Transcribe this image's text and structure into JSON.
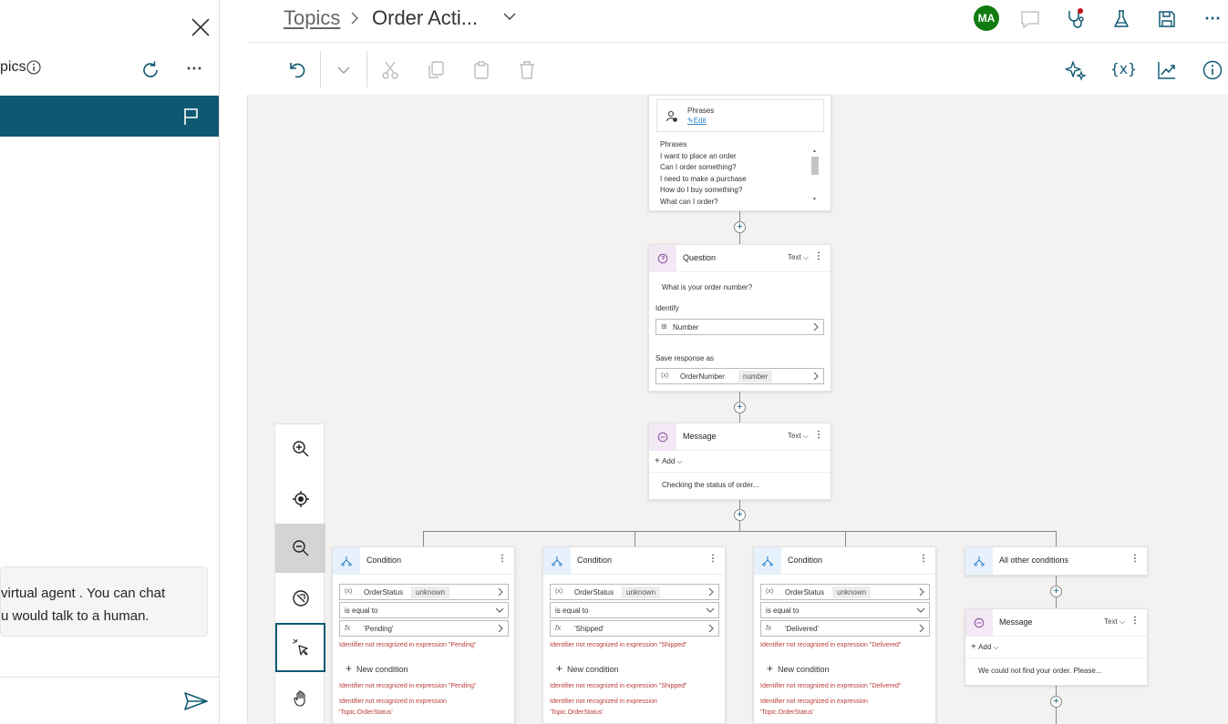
{
  "chat": {
    "title": "pics",
    "more": "⋯",
    "bubble_line1": " virtual agent . You can chat",
    "bubble_line2": "u would talk to a human."
  },
  "header": {
    "crumb_root": "Topics",
    "crumb_current": "Order Acti...",
    "avatar_initials": "MA",
    "more": "⋯"
  },
  "canvas": {
    "trigger": {
      "label": "Phrases",
      "edit": "Edit",
      "list_title": "Phrases",
      "phrases": [
        "I want to place an order",
        "Can I order something?",
        "I need to make a purchase",
        "How do I buy something?",
        "What can I order?"
      ]
    },
    "question": {
      "title": "Question",
      "type": "Text",
      "prompt": "What is your order number?",
      "identify_label": "Identify",
      "identify_value": "Number",
      "save_label": "Save response as",
      "var_name": "OrderNumber",
      "var_type": "number"
    },
    "message": {
      "title": "Message",
      "type": "Text",
      "add": "Add",
      "text": "Checking the status of order..."
    },
    "conditions": [
      {
        "title": "Condition",
        "var": "OrderStatus",
        "var_type": "unknown",
        "operator": "is equal to",
        "value": "'Pending'",
        "err1": "Identifier not recognized in expression \"Pending\"",
        "new": "New condition",
        "err2": "Identifier not recognized in expression \"Pending\"",
        "err3a": "Identifier not recognized in expression",
        "err3b": "'Topic.OrderStatus'"
      },
      {
        "title": "Condition",
        "var": "OrderStatus",
        "var_type": "unknown",
        "operator": "is equal to",
        "value": "'Shipped'",
        "err1": "Identifier not recognized in expression \"Shipped\"",
        "new": "New condition",
        "err2": "Identifier not recognized in expression \"Shipped\"",
        "err3a": "Identifier not recognized in expression",
        "err3b": "'Topic.OrderStatus'"
      },
      {
        "title": "Condition",
        "var": "OrderStatus",
        "var_type": "unknown",
        "operator": "is equal to",
        "value": "'Delivered'",
        "err1": "Identifier not recognized in expression \"Delivered\"",
        "new": "New condition",
        "err2": "Identifier not recognized in expression \"Delivered\"",
        "err3a": "Identifier not recognized in expression",
        "err3b": "'Topic.OrderStatus'"
      }
    ],
    "other": {
      "title": "All other conditions",
      "msg_title": "Message",
      "msg_type": "Text",
      "add": "Add",
      "msg_text": "We could not find your order. Please..."
    }
  },
  "colors": {
    "accent": "#0e5872",
    "avatar": "#107c10",
    "error": "#b83a3a"
  }
}
